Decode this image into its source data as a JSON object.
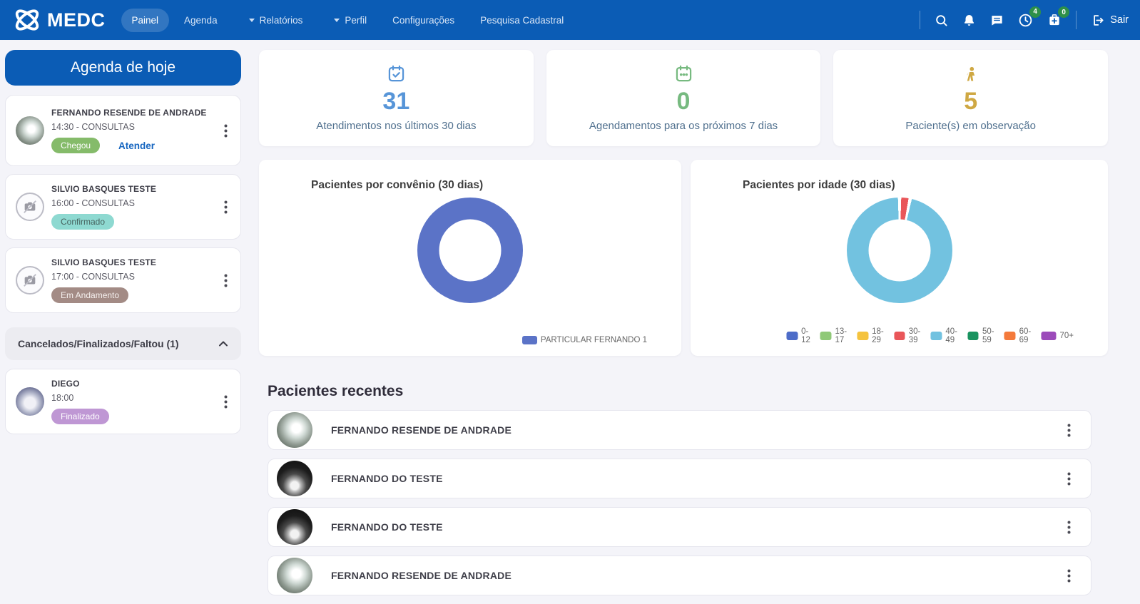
{
  "navbar": {
    "brand": "MEDC",
    "items": [
      {
        "label": "Painel",
        "active": true,
        "dropdown": false
      },
      {
        "label": "Agenda",
        "active": false,
        "dropdown": false
      },
      {
        "label": "Relatórios",
        "active": false,
        "dropdown": true
      },
      {
        "label": "Perfil",
        "active": false,
        "dropdown": true
      },
      {
        "label": "Configurações",
        "active": false,
        "dropdown": false
      },
      {
        "label": "Pesquisa Cadastral",
        "active": false,
        "dropdown": false
      }
    ],
    "notification_badges": {
      "clock": "4",
      "medkit": "0"
    },
    "logout_label": "Sair",
    "colors": {
      "bar": "#0b5cb5",
      "badge": "#2e9049"
    }
  },
  "sidebar": {
    "agenda_button_label": "Agenda de hoje",
    "appointments": [
      {
        "name": "FERNANDO RESENDE DE ANDRADE",
        "time": "14:30 - CONSULTAS",
        "status": "Chegou",
        "status_bg": "#85bb6a",
        "status_fg": "#ffffff",
        "action": "Atender"
      },
      {
        "name": "SILVIO BASQUES TESTE",
        "time": "16:00 - CONSULTAS",
        "status": "Confirmado",
        "status_bg": "#8ed9d1",
        "status_fg": "#46635f"
      },
      {
        "name": "SILVIO BASQUES TESTE",
        "time": "17:00 - CONSULTAS",
        "status": "Em Andamento",
        "status_bg": "#a38b85",
        "status_fg": "#f5f0ee"
      }
    ],
    "collapsed_header": {
      "title": "Cancelados/Finalizados/Faltou (1)"
    },
    "finished_appointments": [
      {
        "name": "DIEGO",
        "time": "18:00",
        "status": "Finalizado",
        "status_bg": "#bf97d4",
        "status_fg": "#ffffff"
      }
    ]
  },
  "stats": [
    {
      "icon": "calendar-check-icon",
      "value": "31",
      "label": "Atendimentos nos últimos 30 dias",
      "color": "#5795d8"
    },
    {
      "icon": "calendar-week-icon",
      "value": "0",
      "label": "Agendamentos para os próximos 7 dias",
      "color": "#77ba80"
    },
    {
      "icon": "patient-icon",
      "value": "5",
      "label": "Paciente(s) em observação",
      "color": "#cfa843"
    }
  ],
  "chart_data": [
    {
      "type": "pie",
      "variant": "doughnut",
      "title": "Pacientes por convênio (30 dias)",
      "labels": [
        "PARTICULAR FERNANDO 1"
      ],
      "values": [
        1
      ],
      "colors": [
        "#5b73c7"
      ],
      "legend_position": "bottom-right"
    },
    {
      "type": "pie",
      "variant": "doughnut",
      "title": "Pacientes por idade (30 dias)",
      "labels": [
        "0-12",
        "13-17",
        "18-29",
        "30-39",
        "40-49",
        "50-59",
        "60-69",
        "70+"
      ],
      "values": [
        0,
        0,
        0,
        1,
        30,
        0,
        0,
        0
      ],
      "colors": [
        "#4d6cc8",
        "#90c978",
        "#f5c33e",
        "#e95659",
        "#72c2e0",
        "#19935f",
        "#f47a3b",
        "#9c4bba"
      ],
      "legend_position": "bottom"
    }
  ],
  "recent": {
    "title": "Pacientes recentes",
    "patients": [
      {
        "name": "FERNANDO RESENDE DE ANDRADE"
      },
      {
        "name": "FERNANDO DO TESTE"
      },
      {
        "name": "FERNANDO DO TESTE"
      },
      {
        "name": "FERNANDO RESENDE DE ANDRADE"
      }
    ]
  }
}
